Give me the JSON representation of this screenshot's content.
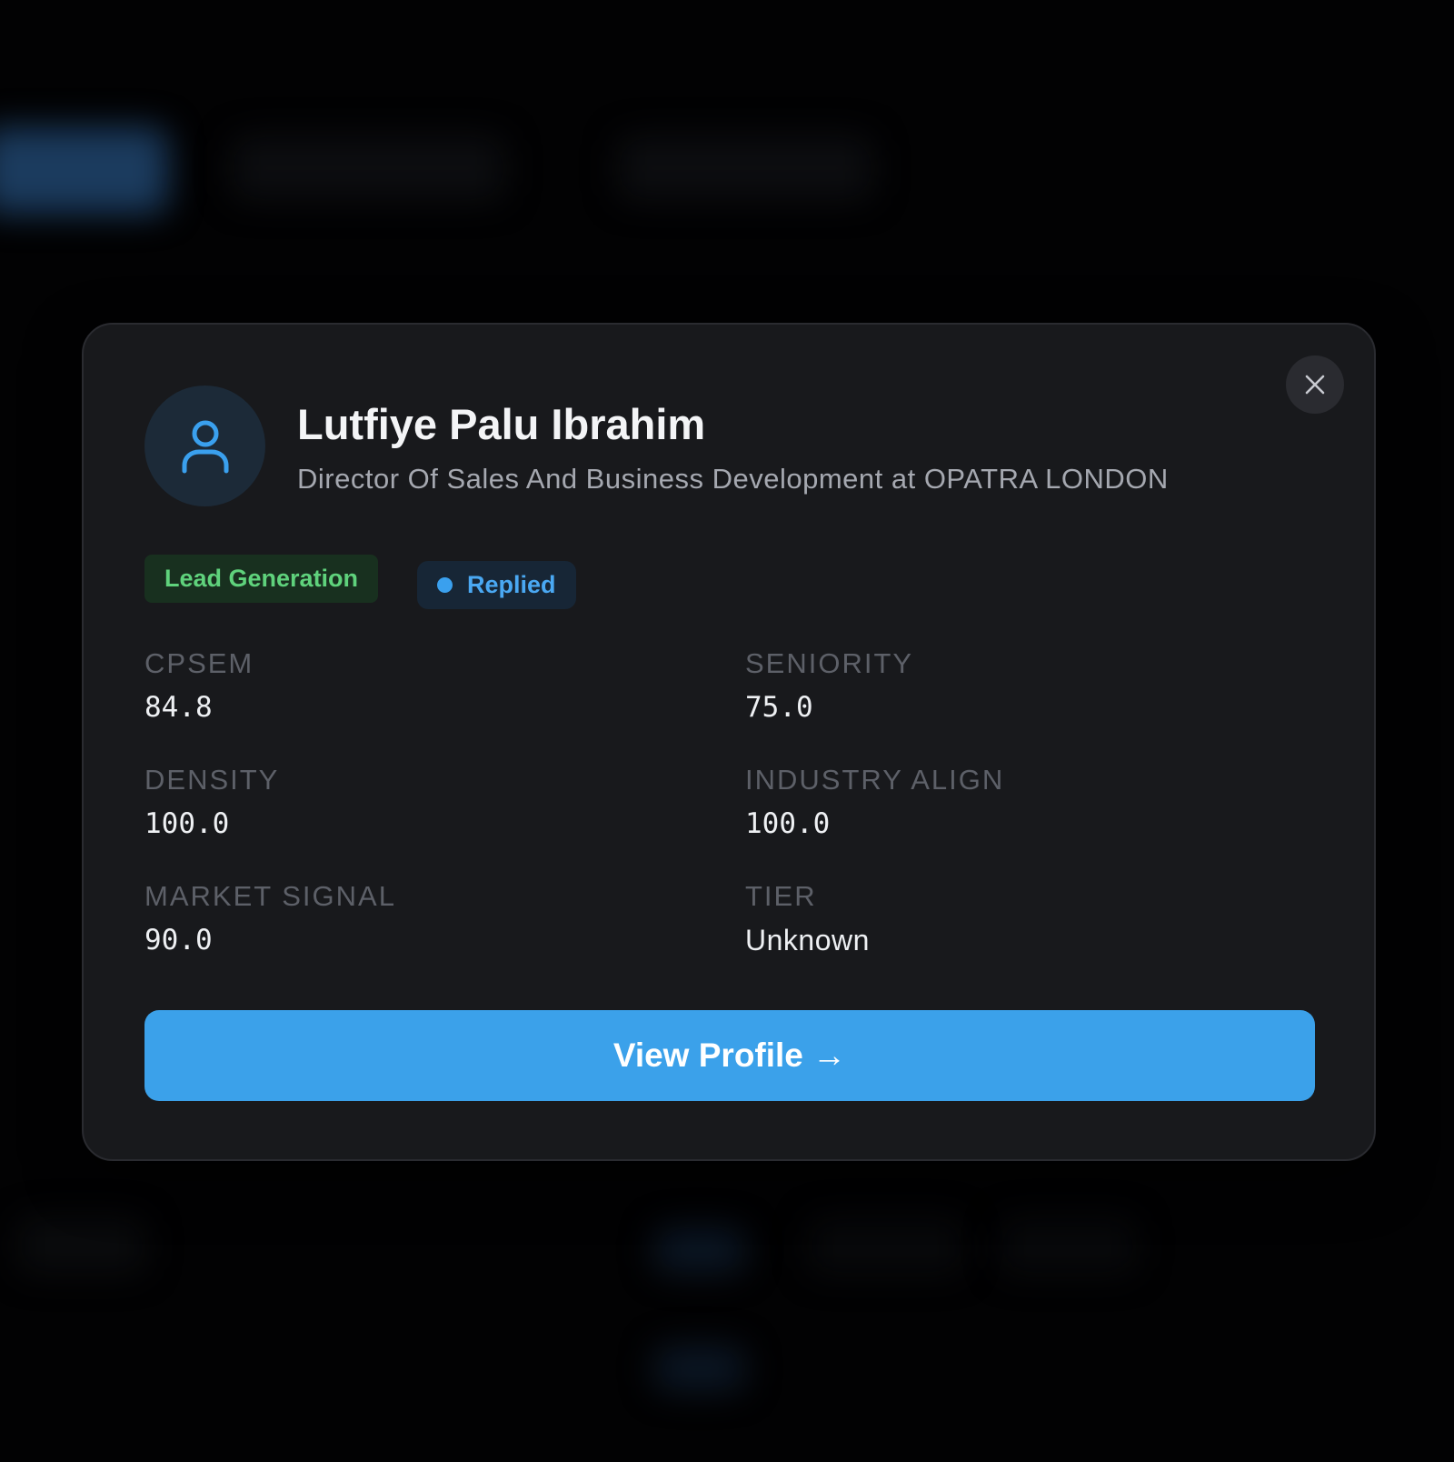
{
  "contact": {
    "name": "Lutfiye Palu Ibrahim",
    "subtitle": "Director Of Sales And Business Development at OPATRA LONDON"
  },
  "tags": {
    "category": "Lead Generation",
    "status": "Replied"
  },
  "metrics": [
    {
      "label": "CPSEM",
      "value": "84.8"
    },
    {
      "label": "SENIORITY",
      "value": "75.0"
    },
    {
      "label": "DENSITY",
      "value": "100.0"
    },
    {
      "label": "INDUSTRY ALIGN",
      "value": "100.0"
    },
    {
      "label": "MARKET SIGNAL",
      "value": "90.0"
    },
    {
      "label": "TIER",
      "value": "Unknown"
    }
  ],
  "actions": {
    "view_profile_label": "View Profile →"
  },
  "icons": {
    "avatar": "user-icon",
    "close": "close-icon"
  },
  "colors": {
    "accent": "#3ba1ea",
    "modal_bg": "#18191c",
    "tag_green_text": "#5fd27c",
    "tag_blue_text": "#4aa8f2"
  }
}
